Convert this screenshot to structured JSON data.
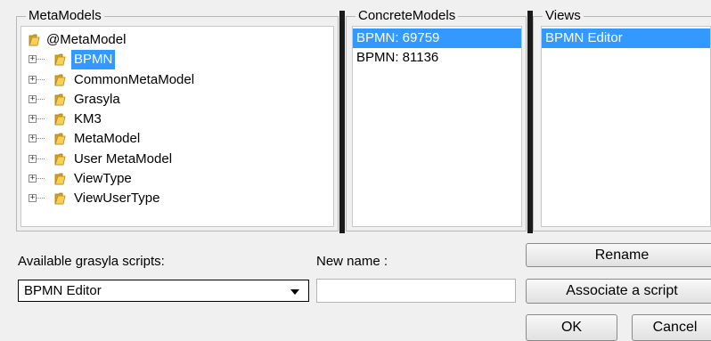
{
  "metamodels_panel": {
    "title": "MetaModels",
    "root": "@MetaModel",
    "items": [
      {
        "label": "BPMN",
        "selected": true
      },
      {
        "label": "CommonMetaModel",
        "selected": false
      },
      {
        "label": "Grasyla",
        "selected": false
      },
      {
        "label": "KM3",
        "selected": false
      },
      {
        "label": "MetaModel",
        "selected": false
      },
      {
        "label": "User MetaModel",
        "selected": false
      },
      {
        "label": "ViewType",
        "selected": false
      },
      {
        "label": "ViewUserType",
        "selected": false
      }
    ]
  },
  "concrete_panel": {
    "title": "ConcreteModels",
    "items": [
      {
        "label": "BPMN: 69759",
        "selected": true
      },
      {
        "label": "BPMN: 81136",
        "selected": false
      }
    ]
  },
  "views_panel": {
    "title": "Views",
    "items": [
      {
        "label": "BPMN Editor",
        "selected": true
      }
    ]
  },
  "scripts": {
    "label": "Available grasyla scripts:",
    "selected": "BPMN Editor"
  },
  "new_name": {
    "label": "New name :",
    "value": ""
  },
  "buttons": {
    "rename": "Rename",
    "associate": "Associate a script",
    "ok": "OK",
    "cancel": "Cancel"
  },
  "colors": {
    "selection": "#3399ff",
    "background": "#f0f0f0"
  }
}
